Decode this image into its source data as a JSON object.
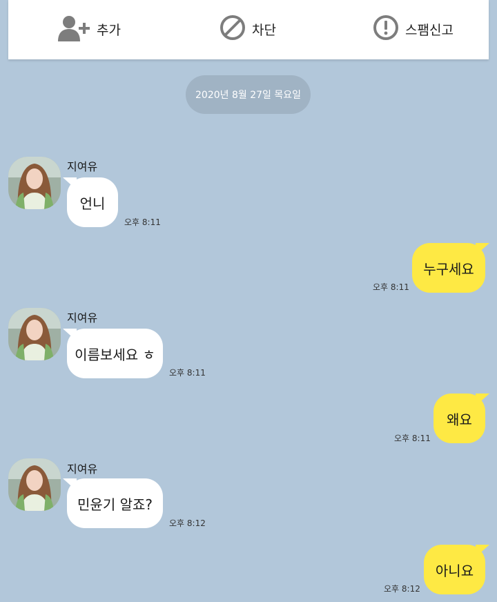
{
  "toolbar": {
    "add_label": "추가",
    "block_label": "차단",
    "spam_label": "스팸신고"
  },
  "date_divider": "2020년 8월 27일 목요일",
  "messages": [
    {
      "direction": "incoming",
      "sender": "지여유",
      "text": "언니",
      "time": "오후 8:11"
    },
    {
      "direction": "outgoing",
      "text": "누구세요",
      "time": "오후 8:11"
    },
    {
      "direction": "incoming",
      "sender": "지여유",
      "text": "이름보세요 ㅎ",
      "time": "오후 8:11"
    },
    {
      "direction": "outgoing",
      "text": "왜요",
      "time": "오후 8:11"
    },
    {
      "direction": "incoming",
      "sender": "지여유",
      "text": "민윤기 알죠?",
      "time": "오후 8:12"
    },
    {
      "direction": "outgoing",
      "text": "아니요",
      "time": "오후 8:12"
    }
  ],
  "colors": {
    "background": "#b2c7da",
    "outgoing_bubble": "#fee944",
    "incoming_bubble": "#ffffff",
    "date_pill": "#a0b3c4"
  }
}
